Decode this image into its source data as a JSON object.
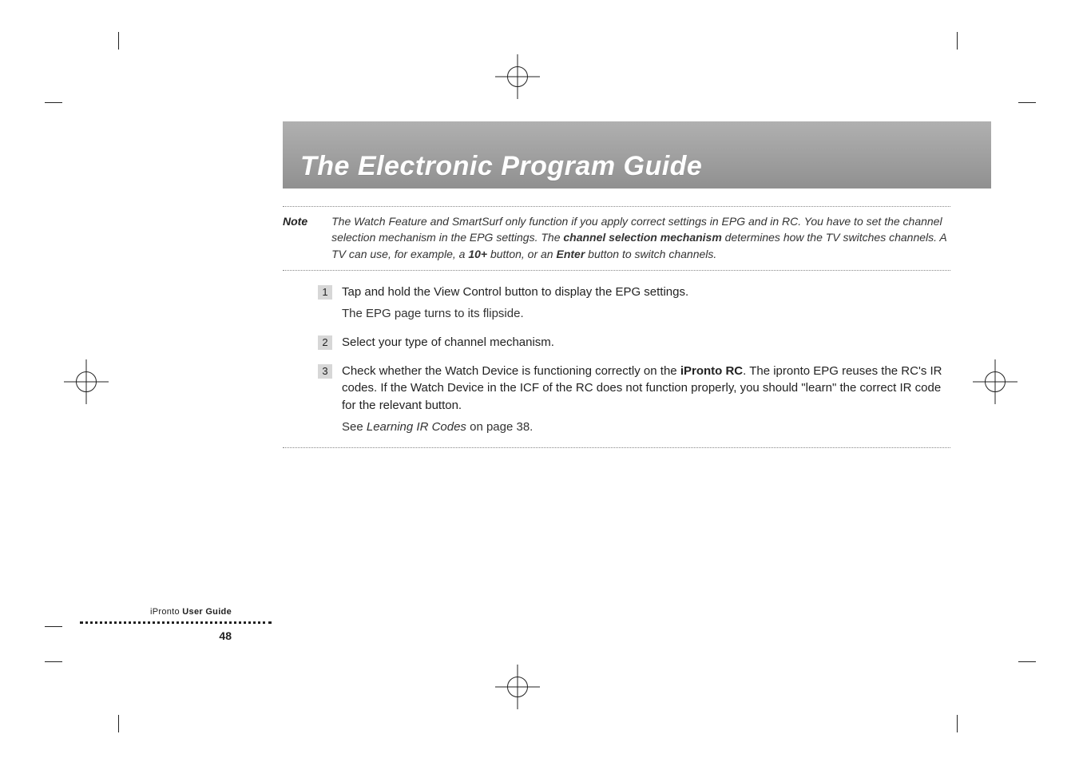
{
  "title": "The Electronic Program Guide",
  "note": {
    "label": "Note",
    "line1": "The Watch Feature and SmartSurf only function if you apply correct settings in EPG and in RC. You have to set the channel selection mechanism in the EPG settings. The ",
    "bold1": "channel selection mechanism",
    "line2": " determines how the TV switches channels. A TV can use, for example, a ",
    "bold2": "10+",
    "line3": " button, or an ",
    "bold3": "Enter",
    "line4": " button to switch channels."
  },
  "steps": [
    {
      "num": "1",
      "main": "Tap and hold the View Control button to display the EPG settings.",
      "sub": "The EPG page turns to its flipside."
    },
    {
      "num": "2",
      "main": "Select your type of channel mechanism."
    },
    {
      "num": "3",
      "main_pre": "Check whether the Watch Device is functioning correctly on the ",
      "main_bold": "iPronto RC",
      "main_post": ". The ipronto EPG reuses the RC's IR codes. If the Watch Device in the ICF of the RC does not function properly, you should \"learn\" the correct IR code for the relevant button.",
      "sub_pre": "See ",
      "sub_ital": "Learning IR Codes",
      "sub_post": " on page 38."
    }
  ],
  "footer": {
    "brand": "iPronto",
    "guide": " User Guide",
    "page": "48"
  }
}
